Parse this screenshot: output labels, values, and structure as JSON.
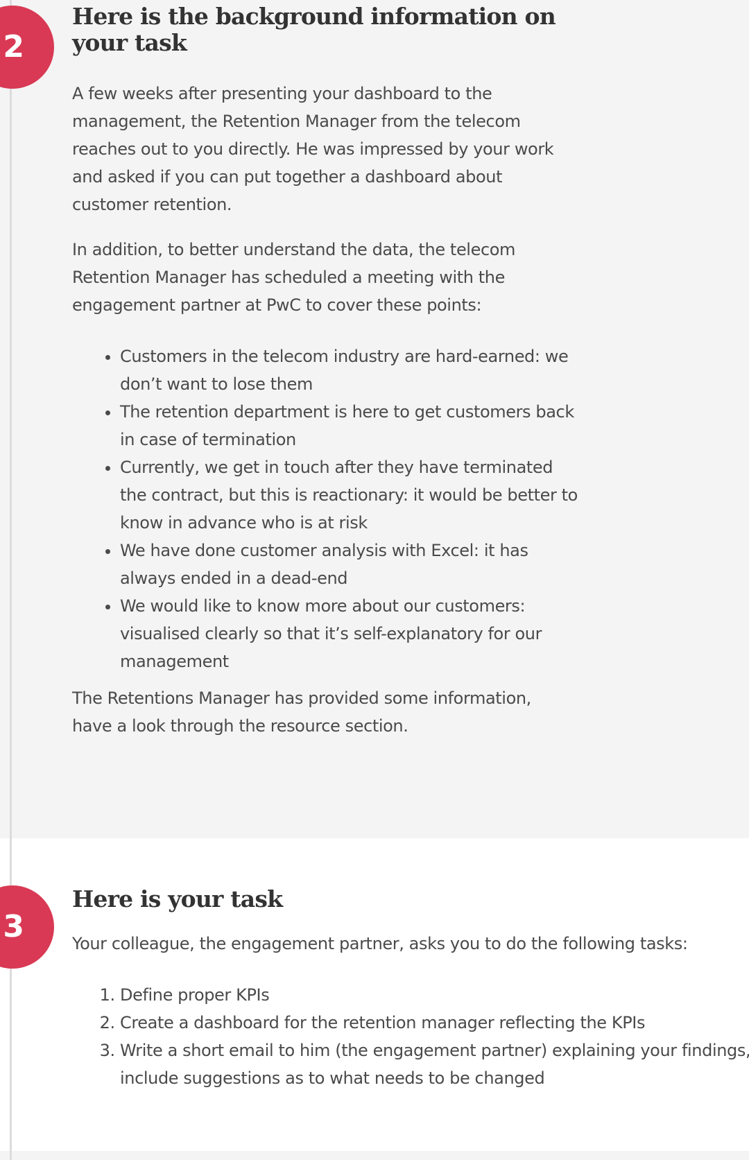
{
  "step2": {
    "number": "2",
    "title": "Here is the background information on your task",
    "paragraph1": "A few weeks after presenting your dashboard to the management, the Retention Manager from the telecom reaches out to you directly. He was impressed by your work and asked if you can put together a dashboard about customer retention.",
    "paragraph2": "In addition, to better understand the data, the telecom Retention Manager has scheduled a meeting with the engagement partner at PwC to cover these points:",
    "points": [
      "Customers in the telecom industry are hard-earned: we don’t want to lose them",
      "The retention department is here to get customers back in case of termination",
      "Currently, we get in touch after they have terminated the contract, but this is reactionary: it would be better to know in advance who is at risk",
      "We  have done customer analysis with Excel: it has always ended in a dead-end",
      "We would like to know more about our customers: visualised clearly so that it’s self-explanatory for our management"
    ],
    "paragraph3": "The Retentions Manager has provided some information, have a look through the resource section."
  },
  "step3": {
    "number": "3",
    "title": "Here is your task",
    "intro": "Your colleague, the engagement partner, asks you to do the following tasks:",
    "tasks": [
      "Define proper KPIs",
      "Create a dashboard for the retention manager reflecting the KPIs",
      "Write a short email to him (the engagement partner) explaining your findings, and include suggestions as to what needs to be changed"
    ]
  },
  "colors": {
    "badge": "#d93954",
    "section_gray": "#f4f4f4",
    "text": "#4a4a4a",
    "heading": "#333333",
    "timeline": "#dcdcdc"
  }
}
